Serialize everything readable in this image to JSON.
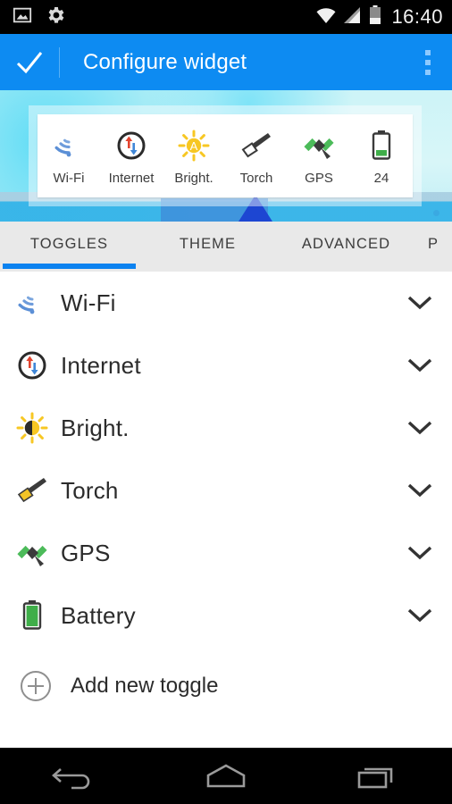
{
  "statusbar": {
    "time": "16:40",
    "left_icons": [
      {
        "name": "photo-icon",
        "label": "photo"
      },
      {
        "name": "settings-gear-icon",
        "label": "settings"
      }
    ],
    "right_icons": [
      {
        "name": "wifi-status-icon",
        "label": "wifi"
      },
      {
        "name": "cell-signal-icon",
        "label": "signal"
      },
      {
        "name": "battery-status-icon",
        "label": "battery"
      }
    ]
  },
  "appbar": {
    "title": "Configure widget",
    "confirm_icon": "check-icon",
    "overflow_icon": "overflow-menu-icon",
    "accent_color": "#0d8bf2"
  },
  "preview": {
    "items": [
      {
        "label": "Wi-Fi",
        "icon": "wifi-icon"
      },
      {
        "label": "Internet",
        "icon": "internet-icon"
      },
      {
        "label": "Bright.",
        "icon": "brightness-icon"
      },
      {
        "label": "Torch",
        "icon": "torch-icon"
      },
      {
        "label": "GPS",
        "icon": "gps-icon"
      },
      {
        "label": "24",
        "icon": "battery-icon"
      }
    ]
  },
  "tabs": [
    {
      "label": "TOGGLES",
      "active": true
    },
    {
      "label": "THEME",
      "active": false
    },
    {
      "label": "ADVANCED",
      "active": false
    },
    {
      "label": "P",
      "active": false
    }
  ],
  "toggles": [
    {
      "label": "Wi-Fi",
      "icon": "wifi-icon",
      "expander": "chevron-down-icon"
    },
    {
      "label": "Internet",
      "icon": "internet-icon",
      "expander": "chevron-down-icon"
    },
    {
      "label": "Bright.",
      "icon": "brightness-icon",
      "expander": "chevron-down-icon"
    },
    {
      "label": "Torch",
      "icon": "torch-icon",
      "expander": "chevron-down-icon"
    },
    {
      "label": "GPS",
      "icon": "gps-icon",
      "expander": "chevron-down-icon"
    },
    {
      "label": "Battery",
      "icon": "battery-icon",
      "expander": "chevron-down-icon"
    }
  ],
  "add_toggle": {
    "label": "Add new toggle",
    "icon": "plus-circle-icon"
  },
  "navbar": {
    "back": "back-icon",
    "home": "home-icon",
    "recents": "recents-icon"
  },
  "colors": {
    "accent": "#0d8bf2",
    "tabbar": "#e9e9e9",
    "battery_green": "#3fae49",
    "brightness_yellow": "#f7c723"
  }
}
